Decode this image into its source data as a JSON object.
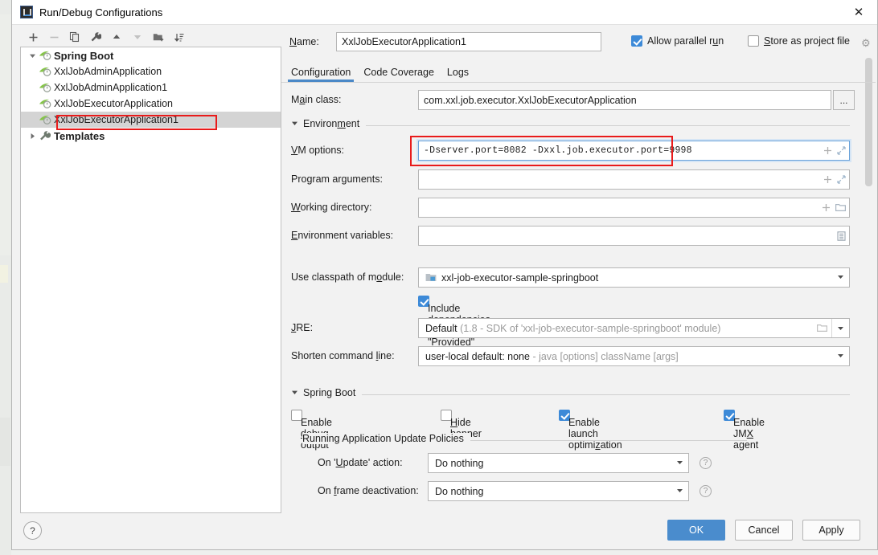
{
  "window": {
    "title": "Run/Debug Configurations",
    "app_icon": "intellij-idea-icon",
    "close_icon": "✕"
  },
  "toolbar": {
    "items": [
      {
        "name": "add-configuration-button",
        "glyph": "+",
        "enabled": true
      },
      {
        "name": "remove-configuration-button",
        "glyph": "−",
        "enabled": false
      },
      {
        "name": "copy-configuration-button",
        "glyph": "copy-icon",
        "enabled": true
      },
      {
        "name": "edit-templates-button",
        "glyph": "wrench-icon",
        "enabled": true
      },
      {
        "name": "move-up-button",
        "glyph": "▲",
        "enabled": true
      },
      {
        "name": "move-down-button",
        "glyph": "▼",
        "enabled": false
      },
      {
        "name": "new-folder-button",
        "glyph": "folder-add-icon",
        "enabled": true
      },
      {
        "name": "sort-configurations-button",
        "glyph": "sort-icon",
        "enabled": true
      }
    ]
  },
  "tree": {
    "group_label": "Spring Boot",
    "group_icon": "spring-boot-icon",
    "items": [
      {
        "label": "XxlJobAdminApplication",
        "icon": "spring-boot-icon",
        "selected": false
      },
      {
        "label": "XxlJobAdminApplication1",
        "icon": "spring-boot-icon",
        "selected": false
      },
      {
        "label": "XxlJobExecutorApplication",
        "icon": "spring-boot-icon",
        "selected": false
      },
      {
        "label": "XxlJobExecutorApplication1",
        "icon": "spring-boot-icon",
        "selected": true
      }
    ],
    "templates_label": "Templates",
    "templates_icon": "wrench-icon"
  },
  "header": {
    "name_label": "Name:",
    "name_value": "XxlJobExecutorApplication1",
    "allow_parallel_run_label": "Allow parallel run",
    "allow_parallel_run_checked": true,
    "store_as_project_file_label": "Store as project file",
    "store_as_project_file_checked": false,
    "settings_gear_icon": "gear-icon"
  },
  "tabs": [
    {
      "label": "Configuration",
      "active": true
    },
    {
      "label": "Code Coverage",
      "active": false
    },
    {
      "label": "Logs",
      "active": false
    }
  ],
  "form": {
    "main_class_label": "Main class:",
    "main_class_value": "com.xxl.job.executor.XxlJobExecutorApplication",
    "main_class_browse": "...",
    "environment_section": "Environment",
    "vm_options_label": "VM options:",
    "vm_options_value": "-Dserver.port=8082 -Dxxl.job.executor.port=9998",
    "vm_options_focused": true,
    "program_arguments_label": "Program arguments:",
    "program_arguments_value": "",
    "working_directory_label": "Working directory:",
    "working_directory_value": "",
    "environment_variables_label": "Environment variables:",
    "environment_variables_value": "",
    "use_classpath_label": "Use classpath of module:",
    "use_classpath_value": "xxl-job-executor-sample-springboot",
    "use_classpath_icon": "module-icon",
    "include_provided_label": "Include dependencies with \"Provided\" scope",
    "include_provided_checked": true,
    "jre_label": "JRE:",
    "jre_value": "Default",
    "jre_hint": "(1.8 - SDK of 'xxl-job-executor-sample-springboot' module)",
    "shorten_command_label": "Shorten command line:",
    "shorten_command_value": "user-local default: none",
    "shorten_command_hint": "- java [options] className [args]"
  },
  "spring_boot": {
    "section_label": "Spring Boot",
    "checkboxes": [
      {
        "label": "Enable debug output",
        "checked": false,
        "name": "enable-debug-output-checkbox"
      },
      {
        "label": "Hide banner",
        "checked": false,
        "name": "hide-banner-checkbox"
      },
      {
        "label": "Enable launch optimization",
        "checked": true,
        "name": "enable-launch-optimization-checkbox"
      },
      {
        "label": "Enable JMX agent",
        "checked": true,
        "name": "enable-jmx-agent-checkbox"
      }
    ],
    "update_policies_label": "Running Application Update Policies",
    "on_update_label": "On 'Update' action:",
    "on_update_value": "Do nothing",
    "on_frame_deactivation_label": "On frame deactivation:",
    "on_frame_deactivation_value": "Do nothing",
    "help_icon": "question-mark-icon"
  },
  "footer": {
    "help_label": "?",
    "ok_label": "OK",
    "cancel_label": "Cancel",
    "apply_label": "Apply"
  },
  "colors": {
    "accent_blue": "#4a8ccd",
    "checkbox_blue": "#3d8ad8",
    "annotation_red": "#e81b1b",
    "selection_gray": "#d4d4d4",
    "dialog_bg": "#f2f2f2"
  }
}
